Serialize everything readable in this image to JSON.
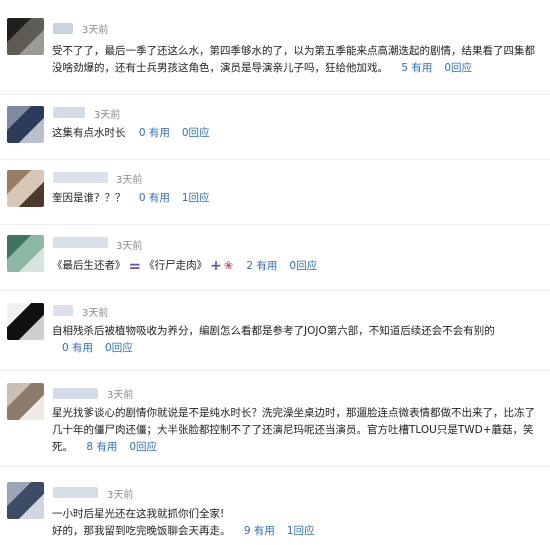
{
  "comments": [
    {
      "time": "3天前",
      "text": "受不了了，最后一季了还这么水，第四季够水的了，以为第五季能来点高潮迭起的剧情，结果看了四集都没啥劲爆的，还有士兵男孩这角色，演员是导演亲儿子吗，狂给他加戏。",
      "useful": "5 有用",
      "replies": "0回应",
      "avatar_colors": [
        "#20201c",
        "#5f5c55",
        "#9c9a94"
      ]
    },
    {
      "time": "3天前",
      "text": "这集有点水时长",
      "useful": "0 有用",
      "replies": "0回应",
      "avatar_colors": [
        "#7d8aa0",
        "#2c3b5a",
        "#b9c0cc"
      ]
    },
    {
      "time": "3天前",
      "text": "奎因是谁？？？",
      "useful": "0 有用",
      "replies": "1回应",
      "avatar_colors": [
        "#9a7c62",
        "#d8c7b6",
        "#4b3a2d"
      ]
    },
    {
      "time": "3天前",
      "text_part1": "《最后生还者》",
      "equals": "=",
      "text_part2": "《行尸走肉》",
      "plus": "+",
      "flower": "❀",
      "useful": "2 有用",
      "replies": "0回应",
      "avatar_colors": [
        "#3f7560",
        "#8bb7a3",
        "#d6e4dd"
      ]
    },
    {
      "time": "3天前",
      "text": "自相残杀后被植物吸收为养分，编剧怎么看都是参考了JOJO第六部，不知道后续还会不会有别的",
      "useful": "0 有用",
      "replies": "0回应",
      "avatar_colors": [
        "#f0f0f0",
        "#111111",
        "#cfcfcf"
      ]
    },
    {
      "time": "3天前",
      "text": "星光找爹谈心的剧情你就说是不是纯水时长？洗完澡坐桌边时，那遛脸连点微表情都做不出来了，比冻了几十年的僵尸肉还僵；大半张脸都控制不了了还演尼玛呢还当演员。官方吐槽TLOU只是TWD+蘑菇，笑死。",
      "useful": "8 有用",
      "replies": "0回应",
      "avatar_colors": [
        "#c9bfb4",
        "#8c7a6a",
        "#efe9e3"
      ]
    },
    {
      "time": "3天前",
      "text_line1": "一小时后星光还在这我就抓你们全家!",
      "text_line2": "好的，那我留到吃完晚饭聊会天再走。",
      "useful": "9 有用",
      "replies": "1回应",
      "avatar_colors": [
        "#9aa6b8",
        "#3c4b66",
        "#d0d6df"
      ]
    }
  ]
}
